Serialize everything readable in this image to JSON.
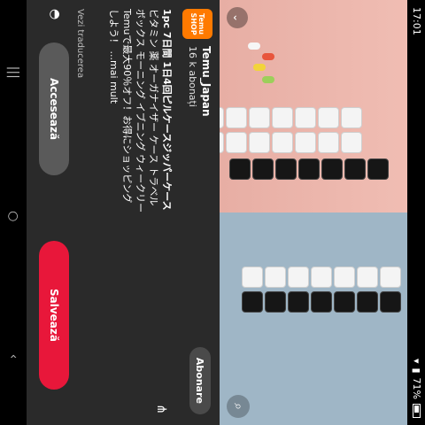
{
  "status": {
    "time": "17:01",
    "battery": "71%"
  },
  "photo": {
    "lens_icon": "visual-search-icon"
  },
  "badge": {
    "line1": "Temu",
    "line2": "SHOP"
  },
  "post": {
    "title": "Temu_Japan",
    "subtitle": "16 k abonați",
    "follow_label": "Abonare",
    "body_bold": "1pc 7日間 1日4回ピルケースジッパーケース",
    "body_line2": "ビタミン 薬 オーガナイザー ケース トラベル",
    "body_line3": "ボックス モーニング イブニング ウィークリー",
    "body_line4": "Temuで最大90％オフ！お得にショッピング",
    "body_line5": "しよう！ ...mai mult",
    "translate": "Vezi traducerea"
  },
  "actions": {
    "access_label": "Accesează",
    "save_label": "Salvează"
  }
}
